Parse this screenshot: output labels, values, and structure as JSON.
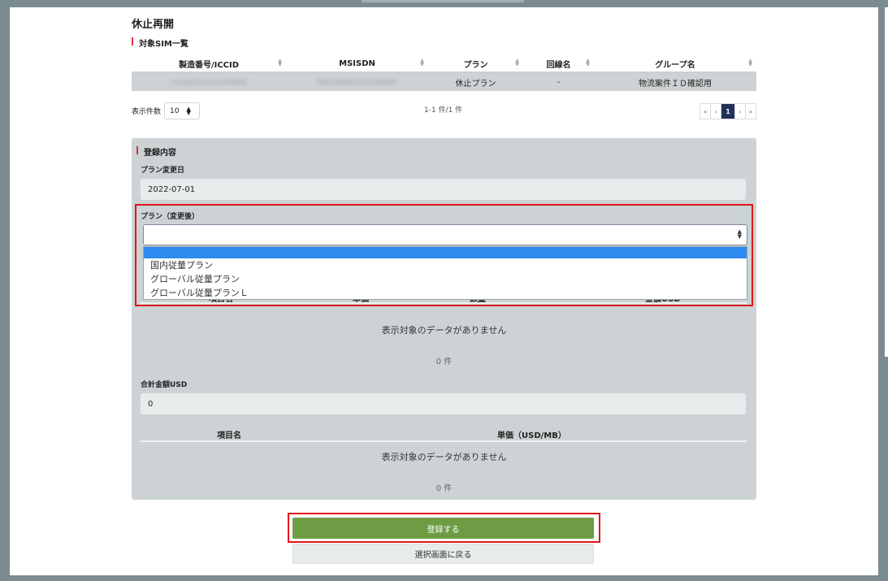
{
  "page": {
    "title": "休止再開",
    "sim_list_label": "対象SIM一覧"
  },
  "sim_table": {
    "headers": [
      "製造番号/ICCID",
      "MSISDN",
      "プラン",
      "回線名",
      "グループ名"
    ],
    "rows": [
      [
        "comprehensive0004",
        "08100006102158604",
        "休止プラン",
        "-",
        "物流案件ＩＤ確認用"
      ]
    ]
  },
  "pager": {
    "per_page_label": "表示件数",
    "per_page_value": "10",
    "info": "1-1 件/1 件",
    "buttons": [
      "«",
      "‹",
      "1",
      "›",
      "»"
    ],
    "current_page": "1"
  },
  "registration": {
    "section_label": "登録内容",
    "plan_change_date_label": "プラン変更日",
    "plan_change_date_value": "2022-07-01",
    "plan_after_label": "プラン（変更後）",
    "plan_after_value": "",
    "plan_options": [
      "国内従量プラン",
      "グローバル従量プラン",
      "グローバル従量プランＬ"
    ]
  },
  "fee_table": {
    "headers_partial": [
      "項目名",
      "単価",
      "数量",
      "金額USD"
    ],
    "empty_message": "表示対象のデータがありません",
    "count": "0 件"
  },
  "total": {
    "label": "合計金額USD",
    "value": "0"
  },
  "unit_table": {
    "headers": [
      "項目名",
      "単価（USD/MB）"
    ],
    "empty_message": "表示対象のデータがありません",
    "count": "0 件"
  },
  "actions": {
    "submit_label": "登録する",
    "back_label": "選択画面に戻る"
  },
  "colors": {
    "accent_red": "#e0141b",
    "submit_green": "#6e9c45",
    "active_page": "#23305c",
    "selected_option": "#2e8cf0"
  }
}
